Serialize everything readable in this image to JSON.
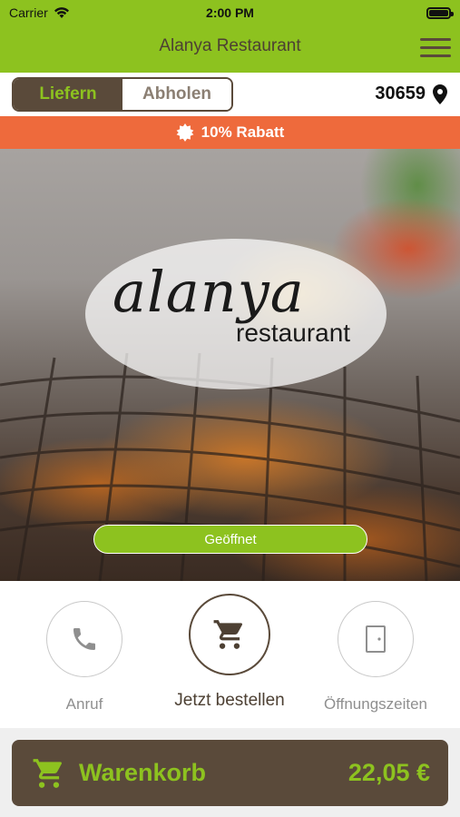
{
  "status_bar": {
    "carrier": "Carrier",
    "time": "2:00 PM"
  },
  "nav": {
    "title": "Alanya Restaurant",
    "menu_icon": "hamburger-menu-icon"
  },
  "mode_toggle": {
    "options": [
      "Liefern",
      "Abholen"
    ],
    "selected": "Liefern"
  },
  "location": {
    "zip": "30659",
    "icon": "location-pin-icon"
  },
  "discount": {
    "label": "10% Rabatt",
    "icon": "badge-icon"
  },
  "hero": {
    "logo_script": "alanya",
    "logo_word": "restaurant",
    "status": "Geöffnet"
  },
  "actions": [
    {
      "label": "Anruf",
      "icon": "phone-icon"
    },
    {
      "label": "Jetzt bestellen",
      "icon": "cart-icon"
    },
    {
      "label": "Öffnungszeiten",
      "icon": "door-icon"
    }
  ],
  "cart": {
    "label": "Warenkorb",
    "price": "22,05 €",
    "icon": "cart-icon"
  },
  "colors": {
    "brand_green": "#8dc21f",
    "brand_brown": "#5a4a3a",
    "discount_orange": "#ee6a3c"
  }
}
